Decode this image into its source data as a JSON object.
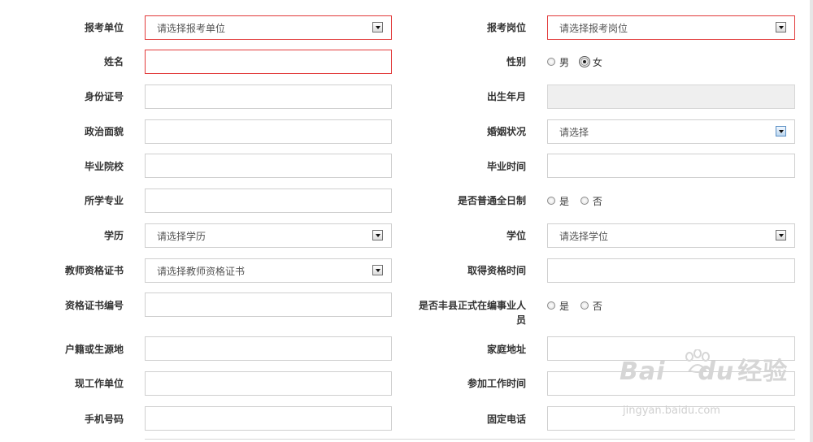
{
  "form": {
    "unit": {
      "label": "报考单位",
      "placeholder": "请选择报考单位"
    },
    "position": {
      "label": "报考岗位",
      "placeholder": "请选择报考岗位"
    },
    "name": {
      "label": "姓名",
      "value": ""
    },
    "gender": {
      "label": "性别",
      "options": [
        "男",
        "女"
      ],
      "selected": "女"
    },
    "id_number": {
      "label": "身份证号",
      "value": ""
    },
    "birth": {
      "label": "出生年月",
      "value": ""
    },
    "political": {
      "label": "政治面貌",
      "value": ""
    },
    "marital": {
      "label": "婚姻状况",
      "placeholder": "请选择"
    },
    "school": {
      "label": "毕业院校",
      "value": ""
    },
    "grad_time": {
      "label": "毕业时间",
      "value": ""
    },
    "major": {
      "label": "所学专业",
      "value": ""
    },
    "fulltime": {
      "label": "是否普通全日制",
      "options": [
        "是",
        "否"
      ]
    },
    "education": {
      "label": "学历",
      "placeholder": "请选择学历"
    },
    "degree": {
      "label": "学位",
      "placeholder": "请选择学位"
    },
    "teacher_cert": {
      "label": "教师资格证书",
      "placeholder": "请选择教师资格证书"
    },
    "cert_time": {
      "label": "取得资格时间",
      "value": ""
    },
    "cert_no": {
      "label": "资格证书编号",
      "value": ""
    },
    "staff": {
      "label_line1": "是否丰县正式在编事业人",
      "label_line2": "员",
      "options": [
        "是",
        "否"
      ]
    },
    "hukou": {
      "label": "户籍或生源地",
      "value": ""
    },
    "address": {
      "label": "家庭地址",
      "value": ""
    },
    "workplace": {
      "label": "现工作单位",
      "value": ""
    },
    "work_time": {
      "label": "参加工作时间",
      "value": ""
    },
    "mobile": {
      "label": "手机号码",
      "value": ""
    },
    "phone": {
      "label": "固定电话",
      "value": ""
    }
  },
  "watermark": {
    "main": "Bai",
    "mid": "du",
    "cn": "经验",
    "url": "jingyan.baidu.com"
  },
  "colors": {
    "error_border": "#e23a3a",
    "field_border": "#cfcfcf",
    "disabled_bg": "#efefef"
  }
}
